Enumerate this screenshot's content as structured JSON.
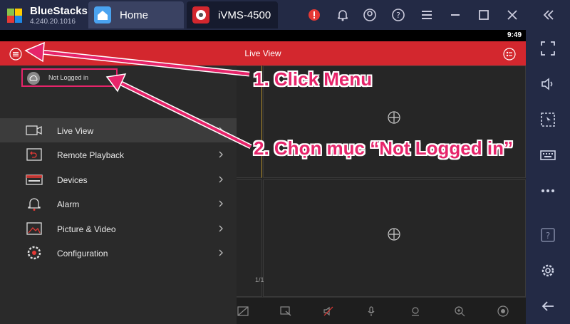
{
  "bluestacks": {
    "name": "BlueStacks",
    "version": "4.240.20.1016",
    "tabs": [
      {
        "label": "Home",
        "icon": "home-icon"
      },
      {
        "label": "iVMS-4500",
        "icon": "ivms-app-icon"
      }
    ],
    "controls": [
      "alert-icon",
      "bell-icon",
      "account-icon",
      "help-icon",
      "menu-icon",
      "minimize-icon",
      "maximize-icon",
      "close-icon",
      "collapse-icon"
    ],
    "sidebar": [
      "fullscreen-icon",
      "volume-icon",
      "screen-record-icon",
      "keyboard-icon",
      "more-icon",
      "help-icon",
      "settings-icon",
      "back-icon"
    ]
  },
  "android": {
    "time": "9:49",
    "appbar": {
      "title": "Live View"
    },
    "pager": "1/1"
  },
  "drawer": {
    "login_label": "Not Logged in",
    "items": [
      {
        "label": "Live View",
        "icon": "camera-icon"
      },
      {
        "label": "Remote Playback",
        "icon": "playback-icon"
      },
      {
        "label": "Devices",
        "icon": "devices-icon"
      },
      {
        "label": "Alarm",
        "icon": "bell-icon"
      },
      {
        "label": "Picture & Video",
        "icon": "picture-icon"
      },
      {
        "label": "Configuration",
        "icon": "gear-icon"
      }
    ]
  },
  "annotations": {
    "step1": "1. Click Menu",
    "step2": "2. Chọn mục “Not Logged in”"
  },
  "colors": {
    "accent_red": "#d3272e",
    "annotation_pink": "#e6246a",
    "bluestacks_bar": "#232a45"
  }
}
